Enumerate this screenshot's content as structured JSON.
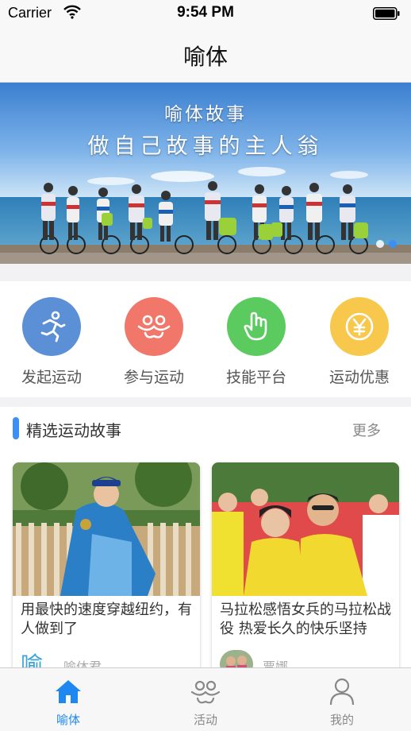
{
  "status_bar": {
    "carrier": "Carrier",
    "time": "9:54 PM"
  },
  "nav": {
    "title": "喻体"
  },
  "banner": {
    "title": "喻体故事",
    "subtitle": "做自己故事的主人翁",
    "page_count": 2,
    "active_page": 2
  },
  "quick_actions": [
    {
      "label": "发起运动",
      "icon": "running-man-icon",
      "color": "#5b8fd6"
    },
    {
      "label": "参与运动",
      "icon": "people-group-icon",
      "color": "#f0776a"
    },
    {
      "label": "技能平台",
      "icon": "hand-icon",
      "color": "#5ccb5f"
    },
    {
      "label": "运动优惠",
      "icon": "yen-coin-icon",
      "color": "#f7c84c"
    }
  ],
  "section": {
    "title": "精选运动故事",
    "more": "更多",
    "accent": "#3b8ff5"
  },
  "stories": [
    {
      "title": "用最快的速度穿越纽约，有人做到了",
      "author": "喻体君"
    },
    {
      "title": "马拉松感悟女兵的马拉松战役 热爱长久的快乐坚持",
      "author": "贾娜"
    }
  ],
  "tabs": [
    {
      "label": "喻体",
      "icon": "home-icon",
      "active": true
    },
    {
      "label": "活动",
      "icon": "people-group-icon",
      "active": false
    },
    {
      "label": "我的",
      "icon": "person-icon",
      "active": false
    }
  ],
  "colors": {
    "active_tab": "#1e88f0",
    "inactive_tab": "#888888"
  }
}
